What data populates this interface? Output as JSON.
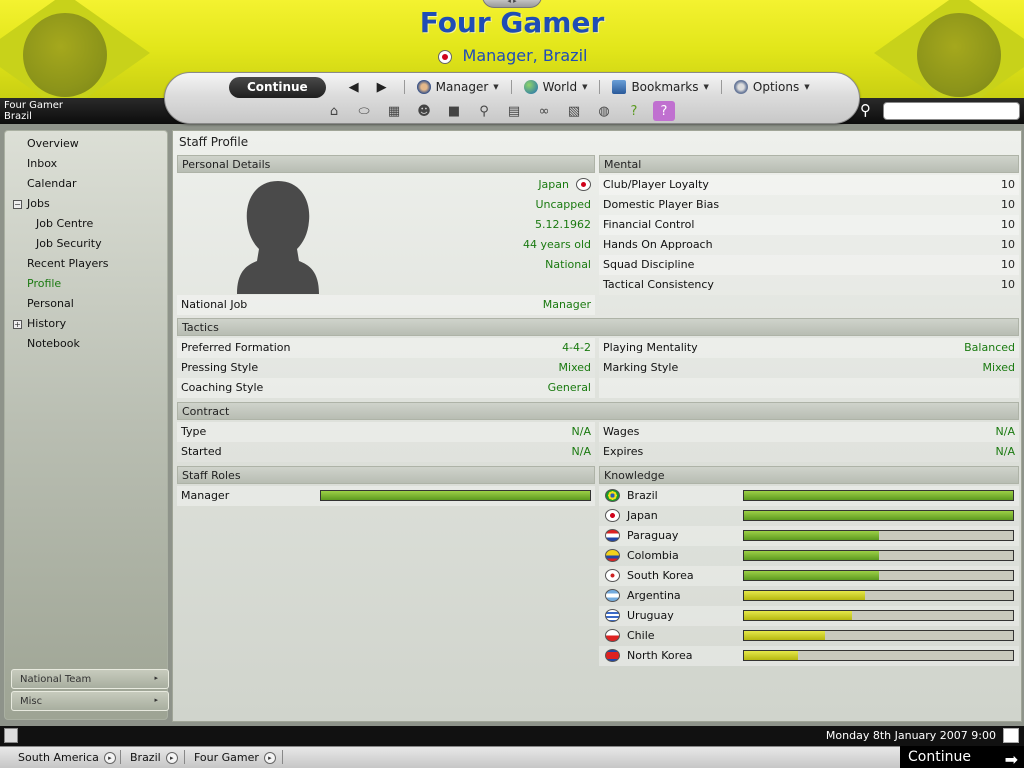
{
  "header": {
    "title": "Four Gamer",
    "subtitle": "Manager, Brazil",
    "profile_name": "Four Gamer",
    "profile_nation": "Brazil",
    "search_placeholder": ""
  },
  "nav": {
    "continue": "Continue",
    "menus": [
      {
        "label": "Manager",
        "icon": "manager-icon"
      },
      {
        "label": "World",
        "icon": "globe-icon"
      },
      {
        "label": "Bookmarks",
        "icon": "bookmarks-icon"
      },
      {
        "label": "Options",
        "icon": "options-icon"
      }
    ],
    "tool_icons": [
      "home-icon",
      "boots-icon",
      "calendar-icon",
      "team-icon",
      "tactics-icon",
      "scout-icon",
      "notes-icon",
      "binoculars-icon",
      "newspaper-icon",
      "world-icon",
      "help-icon",
      "about-icon"
    ]
  },
  "sidebar": {
    "items": [
      "Overview",
      "Inbox",
      "Calendar",
      "Jobs",
      "Job Centre",
      "Job Security",
      "Recent Players",
      "Profile",
      "Personal",
      "History",
      "Notebook"
    ],
    "panels": [
      "National Team",
      "Misc"
    ]
  },
  "main": {
    "title": "Staff Profile",
    "personal": {
      "header": "Personal Details",
      "nationality": "Japan",
      "caps": "Uncapped",
      "dob": "5.12.1962",
      "age": "44 years old",
      "level": "National",
      "job_label": "National Job",
      "job_value": "Manager"
    },
    "mental": {
      "header": "Mental",
      "rows": [
        {
          "label": "Club/Player Loyalty",
          "value": "10"
        },
        {
          "label": "Domestic Player Bias",
          "value": "10"
        },
        {
          "label": "Financial Control",
          "value": "10"
        },
        {
          "label": "Hands On Approach",
          "value": "10"
        },
        {
          "label": "Squad Discipline",
          "value": "10"
        },
        {
          "label": "Tactical Consistency",
          "value": "10"
        }
      ]
    },
    "tactics": {
      "header": "Tactics",
      "left": [
        {
          "label": "Preferred Formation",
          "value": "4-4-2"
        },
        {
          "label": "Pressing Style",
          "value": "Mixed"
        },
        {
          "label": "Coaching Style",
          "value": "General"
        }
      ],
      "right": [
        {
          "label": "Playing Mentality",
          "value": "Balanced"
        },
        {
          "label": "Marking Style",
          "value": "Mixed"
        }
      ]
    },
    "contract": {
      "header": "Contract",
      "left": [
        {
          "label": "Type",
          "value": "N/A"
        },
        {
          "label": "Started",
          "value": "N/A"
        }
      ],
      "right": [
        {
          "label": "Wages",
          "value": "N/A"
        },
        {
          "label": "Expires",
          "value": "N/A"
        }
      ]
    },
    "staff_roles": {
      "header": "Staff Roles",
      "rows": [
        {
          "label": "Manager",
          "level": 1.0
        }
      ]
    },
    "knowledge": {
      "header": "Knowledge",
      "rows": [
        {
          "label": "Brazil",
          "level": 1.0,
          "flag": "brazil"
        },
        {
          "label": "Japan",
          "level": 1.0,
          "flag": "japan"
        },
        {
          "label": "Paraguay",
          "level": 0.5,
          "flag": "paraguay"
        },
        {
          "label": "Colombia",
          "level": 0.5,
          "flag": "colombia"
        },
        {
          "label": "South Korea",
          "level": 0.5,
          "flag": "south-korea"
        },
        {
          "label": "Argentina",
          "level": 0.45,
          "flag": "argentina"
        },
        {
          "label": "Uruguay",
          "level": 0.4,
          "flag": "uruguay"
        },
        {
          "label": "Chile",
          "level": 0.3,
          "flag": "chile"
        },
        {
          "label": "North Korea",
          "level": 0.2,
          "flag": "north-korea"
        }
      ]
    }
  },
  "status": {
    "date": "Monday 8th January 2007 9:00"
  },
  "breadcrumbs": [
    "South America",
    "Brazil",
    "Four Gamer"
  ],
  "bottom_continue": "Continue"
}
